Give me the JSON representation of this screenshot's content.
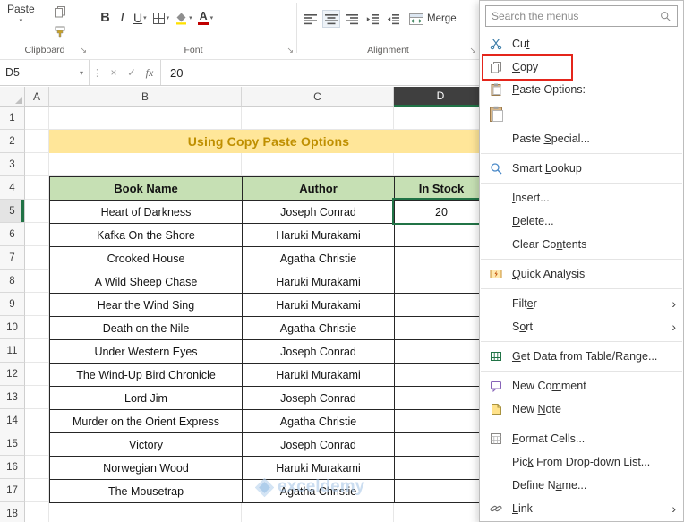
{
  "ribbon": {
    "paste_label": "Paste",
    "group_labels": [
      "Clipboard",
      "Font",
      "Alignment"
    ],
    "buttons": {
      "bold": "B",
      "italic": "I",
      "underline": "U",
      "font_color_label": "A",
      "merge": "Merge"
    }
  },
  "formula_bar": {
    "name_box": "D5",
    "cancel": "×",
    "enter": "✓",
    "fx": "fx",
    "value": "20"
  },
  "grid": {
    "columns": [
      "A",
      "B",
      "C",
      "D"
    ],
    "row_count": 18,
    "selected_column": "D",
    "selected_row": 5,
    "title": "Using Copy Paste Options"
  },
  "table": {
    "headers": [
      "Book Name",
      "Author",
      "In Stock"
    ],
    "rows": [
      [
        "Heart of Darkness",
        "Joseph Conrad",
        "20"
      ],
      [
        "Kafka On the Shore",
        "Haruki Murakami",
        ""
      ],
      [
        "Crooked House",
        "Agatha Christie",
        ""
      ],
      [
        "A Wild Sheep Chase",
        "Haruki Murakami",
        ""
      ],
      [
        "Hear the Wind Sing",
        "Haruki Murakami",
        ""
      ],
      [
        "Death on the Nile",
        "Agatha Christie",
        ""
      ],
      [
        "Under Western Eyes",
        "Joseph Conrad",
        ""
      ],
      [
        "The Wind-Up Bird Chronicle",
        "Haruki Murakami",
        ""
      ],
      [
        "Lord Jim",
        "Joseph Conrad",
        ""
      ],
      [
        "Murder on the Orient Express",
        "Agatha Christie",
        ""
      ],
      [
        "Victory",
        "Joseph Conrad",
        ""
      ],
      [
        "Norwegian Wood",
        "Haruki Murakami",
        ""
      ],
      [
        "The Mousetrap",
        "Agatha Christie",
        ""
      ]
    ]
  },
  "selection": {
    "cell": "D5",
    "value": "20"
  },
  "context_menu": {
    "search_placeholder": "Search the menus",
    "items": [
      {
        "label": "Cut",
        "icon": "scissors-icon",
        "accel": 2
      },
      {
        "label": "Copy",
        "icon": "copy-icon",
        "accel": 0,
        "annotated": true
      },
      {
        "label": "Paste Options:",
        "icon": "paste-options-icon",
        "accel": 0,
        "kind": "header"
      },
      {
        "label": "",
        "icon": "paste-icon",
        "kind": "paste-button"
      },
      {
        "label": "Paste Special...",
        "accel": 6,
        "sep_after": true
      },
      {
        "label": "Smart Lookup",
        "icon": "smart-lookup-icon",
        "accel": 6,
        "sep_after": true
      },
      {
        "label": "Insert...",
        "accel": 0
      },
      {
        "label": "Delete...",
        "accel": 0
      },
      {
        "label": "Clear Contents",
        "accel": 8,
        "sep_after": true
      },
      {
        "label": "Quick Analysis",
        "icon": "quick-analysis-icon",
        "accel": 0,
        "sep_after": true
      },
      {
        "label": "Filter",
        "submenu": true,
        "accel": 4
      },
      {
        "label": "Sort",
        "submenu": true,
        "accel": 1,
        "sep_after": true
      },
      {
        "label": "Get Data from Table/Range...",
        "icon": "get-data-icon",
        "accel": 0,
        "sep_after": true
      },
      {
        "label": "New Comment",
        "icon": "new-comment-icon",
        "accel": 6
      },
      {
        "label": "New Note",
        "icon": "new-note-icon",
        "accel": 4,
        "sep_after": true
      },
      {
        "label": "Format Cells...",
        "icon": "format-cells-icon",
        "accel": 0
      },
      {
        "label": "Pick From Drop-down List...",
        "accel": 3
      },
      {
        "label": "Define Name...",
        "accel": 8
      },
      {
        "label": "Link",
        "icon": "link-icon",
        "submenu": true,
        "accel": 0
      }
    ]
  },
  "watermark": {
    "text": "exceldemy"
  },
  "colors": {
    "title_bg": "#FFE699",
    "title_text": "#BF8F00",
    "table_header_bg": "#C6E0B4",
    "selection_border": "#217346",
    "annotation_red": "#E4251B",
    "selected_col_header": "#3F3F3F",
    "watermark_blue": "#A9C7E7"
  }
}
